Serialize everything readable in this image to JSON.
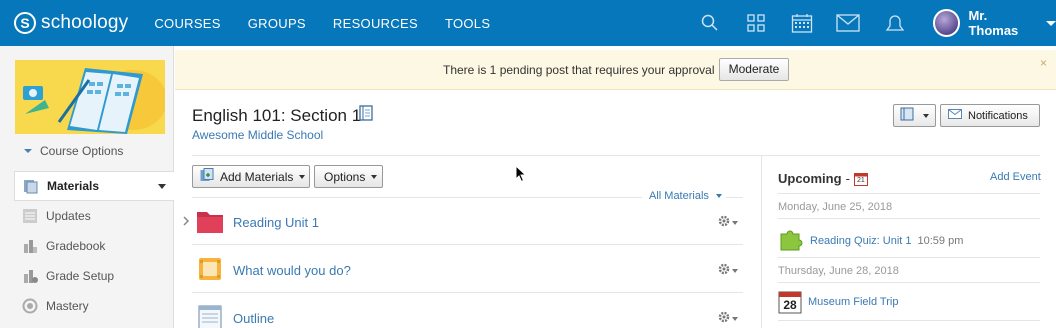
{
  "topnav": {
    "logo_mark": "S",
    "logo_text": "schoology",
    "links": [
      "COURSES",
      "GROUPS",
      "RESOURCES",
      "TOOLS"
    ],
    "icons": [
      "search-icon",
      "apps-grid-icon",
      "calendar-icon",
      "mail-icon",
      "notifications-icon"
    ],
    "user_name": "Mr. Thomas"
  },
  "banner": {
    "message": "There is 1 pending post that requires your approval",
    "button_label": "Moderate",
    "close": "×"
  },
  "sidebar": {
    "course_options": "Course Options",
    "items": [
      {
        "label": "Materials",
        "icon": "materials-icon",
        "active": true
      },
      {
        "label": "Updates",
        "icon": "updates-icon"
      },
      {
        "label": "Gradebook",
        "icon": "gradebook-icon"
      },
      {
        "label": "Grade Setup",
        "icon": "grade-setup-icon"
      },
      {
        "label": "Mastery",
        "icon": "mastery-icon"
      }
    ]
  },
  "course": {
    "title": "English 101: Section 1",
    "school": "Awesome Middle School",
    "notifications_label": "Notifications"
  },
  "toolbar": {
    "add_materials": "Add Materials",
    "options": "Options",
    "filter": "All Materials"
  },
  "materials": [
    {
      "title": "Reading Unit 1",
      "type": "folder"
    },
    {
      "title": "What would you do?",
      "type": "discussion"
    },
    {
      "title": "Outline",
      "type": "page"
    }
  ],
  "upcoming": {
    "title": "Upcoming",
    "separator": "-",
    "calendar_day": "21",
    "add_event": "Add Event",
    "groups": [
      {
        "date": "Monday, June 25, 2018",
        "event": "Reading Quiz: Unit 1",
        "time": "10:59 pm"
      },
      {
        "date": "Thursday, June 28, 2018",
        "event": "Museum Field Trip",
        "day": "28"
      }
    ]
  },
  "colors": {
    "nav_bg": "#0677ba",
    "link": "#3a7ab3",
    "banner_bg": "#fcf8e3",
    "folder": "#e0405a"
  }
}
